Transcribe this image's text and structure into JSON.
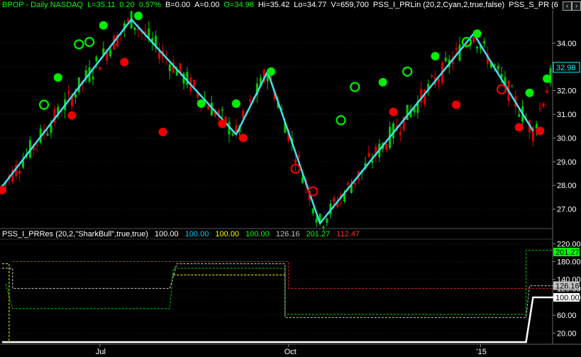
{
  "header": {
    "symbol": "BPOP - Daily  NASDAQ",
    "last": "L=35.11",
    "change": "0.20",
    "change_pct": "0.57%",
    "bid": "B=0.00",
    "ask": "A=0.00",
    "open": "O=34.98",
    "high": "Hi=35.42",
    "low": "Lo=34.77",
    "volume": "V=659,700",
    "indicator1": "PSS_I_PRLin (20,2,Cyan,2,true,false)",
    "indicator2": "PSS_S_PR (6"
  },
  "subpanel": {
    "name": "PSS_I_PRRes (20,2,\"SharkBull\",true,true)",
    "values": [
      {
        "text": "100.00",
        "color": "#ffffff"
      },
      {
        "text": "100.00",
        "color": "#00ccff"
      },
      {
        "text": "100.00",
        "color": "#ffff00"
      },
      {
        "text": "100.00",
        "color": "#00ff00"
      },
      {
        "text": "126.16",
        "color": "#c0c0c0"
      },
      {
        "text": "201.27",
        "color": "#00ff00"
      },
      {
        "text": "112.47",
        "color": "#ff3030"
      }
    ]
  },
  "window_buttons": {
    "left": "‹",
    "right": "›"
  },
  "colors": {
    "background": "#000000",
    "up": "#00cc00",
    "down": "#dd0000",
    "zigzag": "#40e0f0",
    "peak": "#00ee00",
    "trough": "#ee0000",
    "price_tag": "#00ffff",
    "axis_text": "#ffffff",
    "grid": "#3a3a3a"
  },
  "chart_data": [
    {
      "type": "candlestick",
      "title": "BPOP - Daily  NASDAQ",
      "ylim": [
        26.3,
        35.4
      ],
      "yticks": [
        "34.00",
        "33.00",
        "32.00",
        "31.00",
        "30.00",
        "29.00",
        "28.00",
        "27.00"
      ],
      "ytick_values": [
        34,
        33,
        32,
        31,
        30,
        29,
        28,
        27
      ],
      "last_price": "32.98",
      "last_price_value": 32.98,
      "x_labels": [
        "Jul",
        "Oct",
        "'15"
      ],
      "x_label_bars": [
        28,
        82,
        137
      ],
      "bar_count": 158,
      "zigzag": [
        {
          "bar": 0,
          "price": 27.95
        },
        {
          "bar": 37,
          "price": 35.0
        },
        {
          "bar": 67,
          "price": 30.15
        },
        {
          "bar": 76,
          "price": 32.8
        },
        {
          "bar": 91,
          "price": 26.4
        },
        {
          "bar": 135,
          "price": 34.4
        },
        {
          "bar": 152,
          "price": 30.3
        }
      ],
      "markers": [
        {
          "bar": 0,
          "price": 27.8,
          "kind": "trough",
          "filled": true
        },
        {
          "bar": 12,
          "price": 31.4,
          "kind": "peak",
          "filled": false
        },
        {
          "bar": 16,
          "price": 32.55,
          "kind": "peak",
          "filled": true
        },
        {
          "bar": 20,
          "price": 30.95,
          "kind": "trough",
          "filled": true
        },
        {
          "bar": 22,
          "price": 33.95,
          "kind": "peak",
          "filled": false
        },
        {
          "bar": 25,
          "price": 34.05,
          "kind": "peak",
          "filled": false
        },
        {
          "bar": 29,
          "price": 34.75,
          "kind": "peak",
          "filled": true
        },
        {
          "bar": 35,
          "price": 33.2,
          "kind": "trough",
          "filled": true
        },
        {
          "bar": 39,
          "price": 35.15,
          "kind": "peak",
          "filled": true
        },
        {
          "bar": 46,
          "price": 30.25,
          "kind": "trough",
          "filled": true
        },
        {
          "bar": 57,
          "price": 31.45,
          "kind": "peak",
          "filled": true
        },
        {
          "bar": 63,
          "price": 30.6,
          "kind": "trough",
          "filled": true
        },
        {
          "bar": 67,
          "price": 31.45,
          "kind": "peak",
          "filled": true
        },
        {
          "bar": 69,
          "price": 30.0,
          "kind": "trough",
          "filled": true
        },
        {
          "bar": 77,
          "price": 32.8,
          "kind": "peak",
          "filled": true
        },
        {
          "bar": 84,
          "price": 28.7,
          "kind": "trough",
          "filled": false
        },
        {
          "bar": 89,
          "price": 27.75,
          "kind": "trough",
          "filled": false
        },
        {
          "bar": 97,
          "price": 30.75,
          "kind": "peak",
          "filled": false
        },
        {
          "bar": 101,
          "price": 32.15,
          "kind": "peak",
          "filled": false
        },
        {
          "bar": 109,
          "price": 32.35,
          "kind": "peak",
          "filled": true
        },
        {
          "bar": 112,
          "price": 31.1,
          "kind": "trough",
          "filled": true
        },
        {
          "bar": 116,
          "price": 32.8,
          "kind": "peak",
          "filled": false
        },
        {
          "bar": 124,
          "price": 33.45,
          "kind": "peak",
          "filled": true
        },
        {
          "bar": 130,
          "price": 31.4,
          "kind": "trough",
          "filled": true
        },
        {
          "bar": 133,
          "price": 34.05,
          "kind": "peak",
          "filled": false
        },
        {
          "bar": 136,
          "price": 34.4,
          "kind": "peak",
          "filled": true
        },
        {
          "bar": 143,
          "price": 32.05,
          "kind": "trough",
          "filled": false
        },
        {
          "bar": 148,
          "price": 30.45,
          "kind": "trough",
          "filled": true
        },
        {
          "bar": 151,
          "price": 31.9,
          "kind": "peak",
          "filled": true
        },
        {
          "bar": 154,
          "price": 30.3,
          "kind": "trough",
          "filled": true
        },
        {
          "bar": 156,
          "price": 32.5,
          "kind": "peak",
          "filled": true
        }
      ]
    },
    {
      "type": "line",
      "title": "PSS_I_PRRes (20,2,\"SharkBull\",true,true)",
      "ylim": [
        0,
        230
      ],
      "yticks": [
        "220.00",
        "180.00",
        "140.00",
        "120.00",
        "100.00",
        "60.00",
        "20.00"
      ],
      "ytick_values": [
        220,
        180,
        140,
        120,
        100,
        60,
        20
      ],
      "value_tags": [
        {
          "text": "201.27",
          "value": 201.27,
          "bg": "#00ff00",
          "fg": "#000000"
        },
        {
          "text": "126.16",
          "value": 126.16,
          "bg": "#c0c0c0",
          "fg": "#000000"
        },
        {
          "text": "100.00",
          "value": 100.0,
          "bg": "#ffffff",
          "fg": "#000000"
        }
      ],
      "series": [
        {
          "color": "#ffffff",
          "width": 2.5,
          "dash": false,
          "points": [
            [
              0,
              0
            ],
            [
              150,
              0
            ],
            [
              152,
              100
            ],
            [
              158,
              100
            ]
          ]
        },
        {
          "color": "#ffff00",
          "width": 1,
          "dash": true,
          "points": [
            [
              0,
              175
            ],
            [
              2,
              175
            ],
            [
              2,
              0
            ],
            [
              3,
              0
            ]
          ]
        },
        {
          "color": "#dd2222",
          "width": 1,
          "dash": true,
          "points": [
            [
              3,
              180
            ],
            [
              48,
              180
            ],
            [
              48,
              180
            ],
            [
              82,
              180
            ],
            [
              82,
              120
            ],
            [
              150,
              120
            ],
            [
              150,
              120
            ],
            [
              158,
              120
            ]
          ]
        },
        {
          "color": "#00cc00",
          "width": 1,
          "dash": true,
          "points": [
            [
              1,
              130
            ],
            [
              3,
              75
            ],
            [
              48,
              75
            ],
            [
              49,
              165
            ],
            [
              81,
              165
            ],
            [
              81,
              62
            ],
            [
              150,
              62
            ],
            [
              150,
              205
            ],
            [
              158,
              205
            ]
          ]
        },
        {
          "color": "#cccccc",
          "width": 1,
          "dash": true,
          "points": [
            [
              0,
              165
            ],
            [
              3,
              165
            ],
            [
              3,
              120
            ],
            [
              48,
              120
            ],
            [
              50,
              175
            ],
            [
              81,
              175
            ],
            [
              81,
              55
            ],
            [
              150,
              55
            ],
            [
              151,
              126
            ],
            [
              158,
              126
            ]
          ]
        },
        {
          "color": "#ffff00",
          "width": 1,
          "dash": true,
          "points": [
            [
              49,
              150
            ],
            [
              81,
              150
            ]
          ]
        }
      ]
    }
  ]
}
